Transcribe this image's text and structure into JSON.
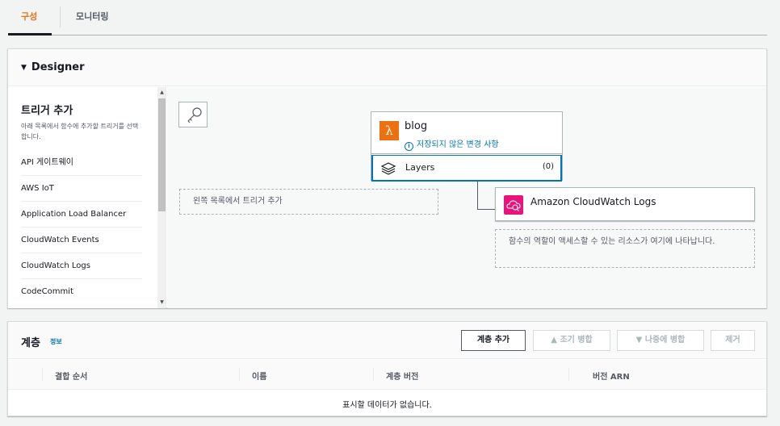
{
  "tabs": [
    {
      "label": "구성",
      "active": true
    },
    {
      "label": "모니터링",
      "active": false
    }
  ],
  "designer": {
    "title": "Designer",
    "sidebar": {
      "title": "트리거 추가",
      "description": "아래 목록에서 함수에 추가할 트리거를 선택합니다.",
      "items": [
        "API 게이트웨이",
        "AWS IoT",
        "Application Load Balancer",
        "CloudWatch Events",
        "CloudWatch Logs",
        "CodeCommit"
      ]
    },
    "trigger_placeholder": "왼쪽 목록에서 트리거 추가",
    "function": {
      "name": "blog",
      "warning": "저장되지 않은 변경 사항",
      "layers_label": "Layers",
      "layers_count": "(0)"
    },
    "destination": {
      "label": "Amazon CloudWatch Logs"
    },
    "resource_placeholder": "함수의 역할이 액세스할 수 있는 리소스가 여기에 나타납니다."
  },
  "layers": {
    "title": "계층",
    "info": "정보",
    "buttons": {
      "add": "계층 추가",
      "merge_up": "▲ 조기 병합",
      "merge_down": "▼ 나중에 병합",
      "remove": "제거"
    },
    "columns": [
      "결합 순서",
      "이름",
      "계층 버전",
      "버전 ARN"
    ],
    "empty_message": "표시할 데이터가 없습니다."
  },
  "colors": {
    "accent": "#ec7211",
    "link": "#0073bb",
    "cloudwatch": "#e7157b"
  }
}
